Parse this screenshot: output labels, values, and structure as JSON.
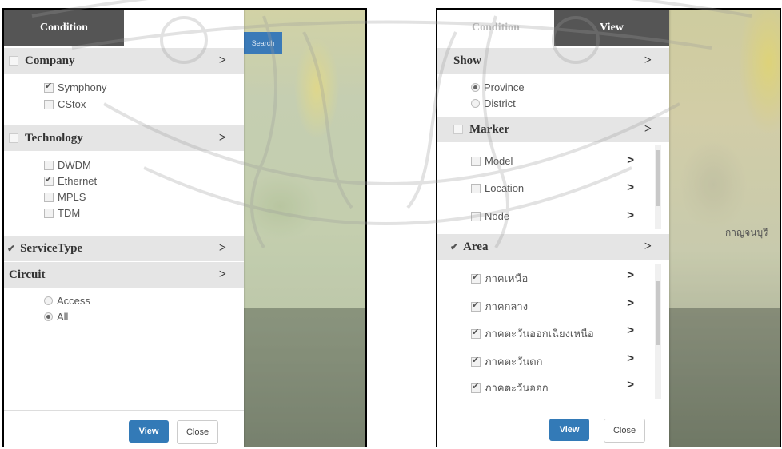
{
  "left": {
    "tabs": {
      "active": "Condition"
    },
    "sections": {
      "company": {
        "label": "Company",
        "items": [
          {
            "label": "Symphony",
            "checked": true
          },
          {
            "label": "CStox",
            "checked": false
          }
        ]
      },
      "technology": {
        "label": "Technology",
        "items": [
          {
            "label": "DWDM",
            "checked": false
          },
          {
            "label": "Ethernet",
            "checked": true
          },
          {
            "label": "MPLS",
            "checked": false
          },
          {
            "label": "TDM",
            "checked": false
          }
        ]
      },
      "servicetype": {
        "label": "ServiceType",
        "checked": true
      },
      "circuit": {
        "label": "Circuit",
        "items": [
          {
            "label": "Access",
            "selected": false
          },
          {
            "label": "All",
            "selected": true
          }
        ]
      }
    },
    "buttons": {
      "view": "View",
      "close": "Close"
    },
    "map": {
      "search_chip": "Search"
    }
  },
  "right": {
    "tabs": {
      "inactive": "Condition",
      "active": "View"
    },
    "sections": {
      "show": {
        "label": "Show",
        "items": [
          {
            "label": "Province",
            "selected": true
          },
          {
            "label": "District",
            "selected": false
          }
        ]
      },
      "marker": {
        "label": "Marker",
        "items": [
          {
            "label": "Model",
            "checked": false
          },
          {
            "label": "Location",
            "checked": false
          },
          {
            "label": "Node",
            "checked": false
          }
        ]
      },
      "area": {
        "label": "Area",
        "checked": true,
        "items": [
          {
            "label": "ภาคเหนือ",
            "checked": true
          },
          {
            "label": "ภาคกลาง",
            "checked": true
          },
          {
            "label": "ภาคตะวันออกเฉียงเหนือ",
            "checked": true
          },
          {
            "label": "ภาคตะวันตก",
            "checked": true
          },
          {
            "label": "ภาคตะวันออก",
            "checked": true
          }
        ]
      }
    },
    "buttons": {
      "view": "View",
      "close": "Close"
    },
    "map": {
      "label_a": "กาญจนบุรี"
    }
  },
  "colors": {
    "tab_active": "#555555",
    "section_bg": "#e5e5e5",
    "primary": "#337ab7"
  },
  "chevron": ">"
}
